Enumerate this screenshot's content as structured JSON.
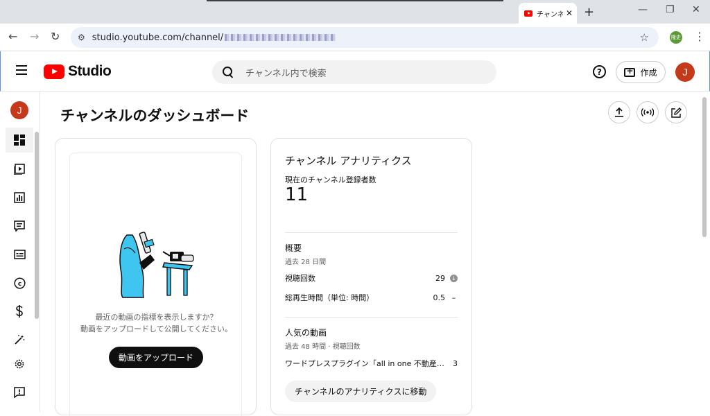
{
  "browser": {
    "tab_title": "チャンネル",
    "url_prefix": "studio.youtube.com/channel/",
    "profile_label": "隆史"
  },
  "header": {
    "logo_text": "Studio",
    "search_placeholder": "チャンネル内で検索",
    "create_label": "作成",
    "avatar_initial": "J"
  },
  "nav": {
    "avatar_initial": "J"
  },
  "page": {
    "title": "チャンネルのダッシュボード"
  },
  "upload_card": {
    "message_line1": "最近の動画の指標を表示しますか？",
    "message_line2": "動画をアップロードして公開してください。",
    "button_label": "動画をアップロード"
  },
  "analytics": {
    "title": "チャンネル アナリティクス",
    "subscribers_label": "現在のチャンネル登録者数",
    "subscribers_value": "11",
    "summary": {
      "heading": "概要",
      "period": "過去 28 日間",
      "views_label": "視聴回数",
      "views_value": "29",
      "watch_label": "総再生時間（単位: 時間）",
      "watch_value": "0.5"
    },
    "popular": {
      "heading": "人気の動画",
      "period": "過去 48 時間 · 視聴回数",
      "video_title": "ワードプレスプラグイン「all in one 不動産」に",
      "video_views": "3"
    },
    "go_button": "チャンネルのアナリティクスに移動"
  },
  "colors": {
    "brand_red": "#ff0000",
    "avatar": "#c5391b",
    "illustration": "#3ec6f0"
  }
}
